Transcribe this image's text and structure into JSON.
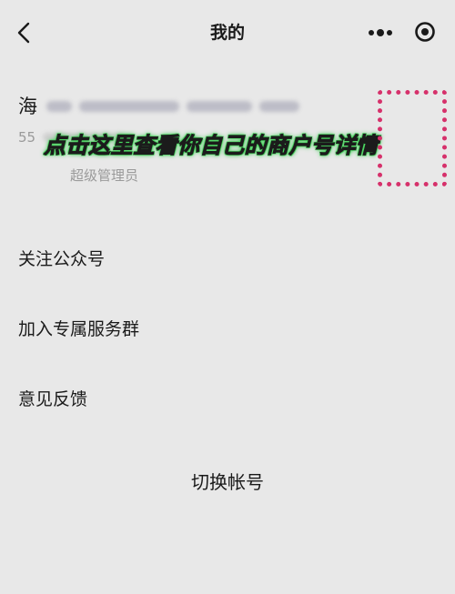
{
  "navbar": {
    "title": "我的",
    "back_icon": "chevron-left-icon",
    "more_icon": "more-dots-icon",
    "target_icon": "target-icon"
  },
  "profile": {
    "merchant_name_prefix": "海",
    "merchant_id_prefix": "55",
    "role": "超级管理员"
  },
  "overlay": {
    "tip_text": "点击这里查看你自己的商户号详情",
    "tip_glow_color": "#3ec453",
    "highlight_color": "#d6316b"
  },
  "menu": {
    "items": [
      {
        "label": "关注公众号"
      },
      {
        "label": "加入专属服务群"
      },
      {
        "label": "意见反馈"
      }
    ]
  },
  "footer": {
    "switch_account_label": "切换帐号"
  }
}
